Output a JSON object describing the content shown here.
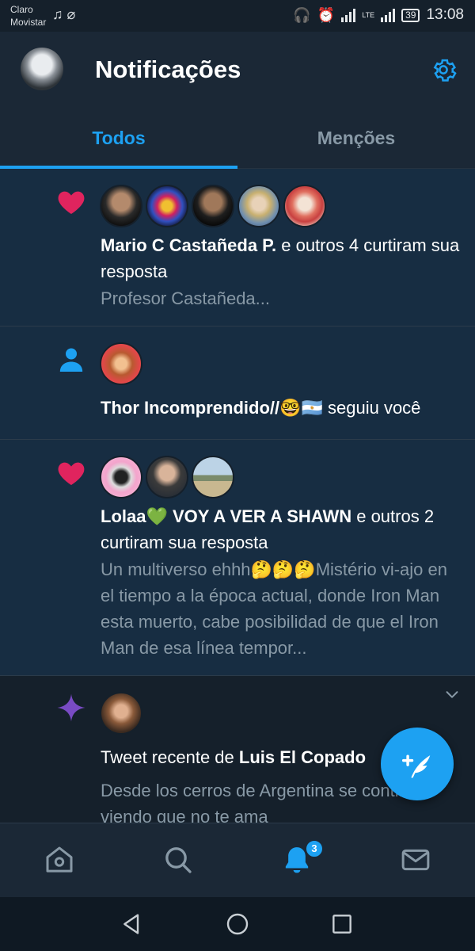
{
  "status_bar": {
    "carrier_1": "Claro",
    "carrier_2": "Movistar",
    "network": "LTE",
    "battery": "39",
    "time": "13:08"
  },
  "header": {
    "title": "Notificações"
  },
  "tabs": [
    {
      "label": "Todos",
      "active": true
    },
    {
      "label": "Menções",
      "active": false
    }
  ],
  "notifications": [
    {
      "type": "like",
      "icon": "heart-icon",
      "actor": "Mario C Castañeda P.",
      "action": " e outros 4 curtiram sua resposta",
      "preview": "Profesor Castañeda..."
    },
    {
      "type": "follow",
      "icon": "person-icon",
      "actor": "Thor Incomprendido//🤓🇦🇷",
      "action": " seguiu você"
    },
    {
      "type": "like",
      "icon": "heart-icon",
      "actor": "Lolaa💚 VOY A VER A SHAWN",
      "action": " e outros 2 curtiram sua resposta",
      "preview": "Un multiverso ehhh🤔🤔🤔Mistério vi-ajo en el tiempo a la época actual, donde Iron Man esta muerto, cabe posibilidad de que el Iron Man de esa línea tempor..."
    },
    {
      "type": "recent_tweet",
      "icon": "sparkle-icon",
      "prefix": "Tweet recente de ",
      "actor": "Luis El Copado",
      "preview": "Desde los cerros de Argentina se continúa viendo que no te ama"
    }
  ],
  "bottom_nav": {
    "items": [
      "home-icon",
      "search-icon",
      "bell-icon",
      "mail-icon"
    ],
    "notification_badge": "3"
  },
  "colors": {
    "background": "#15202b",
    "unread_background": "#172d42",
    "accent": "#1da1f2",
    "like": "#e0245e",
    "recent": "#794bc4",
    "secondary_text": "#8899a6"
  }
}
